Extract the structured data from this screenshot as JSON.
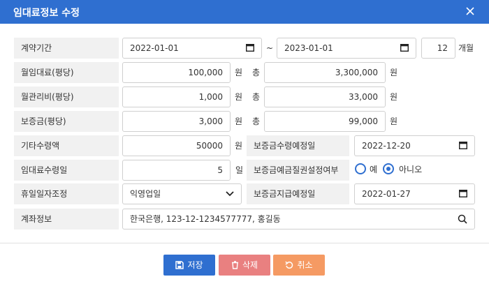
{
  "dialog": {
    "title": "임대료정보 수정"
  },
  "labels": {
    "contract_period": "계약기간",
    "monthly_rent": "월임대료(평당)",
    "monthly_mgmt": "월관리비(평당)",
    "deposit": "보증금(평당)",
    "other_income": "기타수령액",
    "rent_receipt_day": "임대료수령일",
    "holiday_adjust": "휴일일자조정",
    "account_info": "계좌정보",
    "deposit_receipt_date": "보증금수령예정일",
    "deposit_pledge": "보증금예금질권설정여부",
    "deposit_payment_date": "보증금지급예정일"
  },
  "contract": {
    "start": "2022-01-01",
    "tilde": "~",
    "end": "2023-01-01",
    "months": "12",
    "months_unit": "개월"
  },
  "rent": {
    "value": "100,000",
    "unit": "원",
    "total_label": "총",
    "total": "3,300,000",
    "total_unit": "원"
  },
  "mgmt": {
    "value": "1,000",
    "unit": "원",
    "total_label": "총",
    "total": "33,000",
    "total_unit": "원"
  },
  "deposit": {
    "value": "3,000",
    "unit": "원",
    "total_label": "총",
    "total": "99,000",
    "total_unit": "원"
  },
  "other_income": {
    "value": "50000",
    "unit": "원"
  },
  "deposit_receipt_date": "2022-12-20",
  "rent_receipt_day": {
    "value": "5",
    "unit": "일"
  },
  "deposit_pledge": {
    "options": [
      "예",
      "아니오"
    ],
    "selected": "아니오"
  },
  "holiday_adjust": {
    "selected": "익영업일"
  },
  "deposit_payment_date": "2022-01-27",
  "account_info": "한국은행, 123-12-1234577777, 홍길동",
  "buttons": {
    "save": {
      "label": "저장",
      "color": "#2f6fd0"
    },
    "delete": {
      "label": "삭제",
      "color": "#e98080"
    },
    "cancel": {
      "label": "취소",
      "color": "#f59a63"
    }
  },
  "colors": {
    "header": "#2f6fd0",
    "label_bg": "#f1f1f1"
  }
}
